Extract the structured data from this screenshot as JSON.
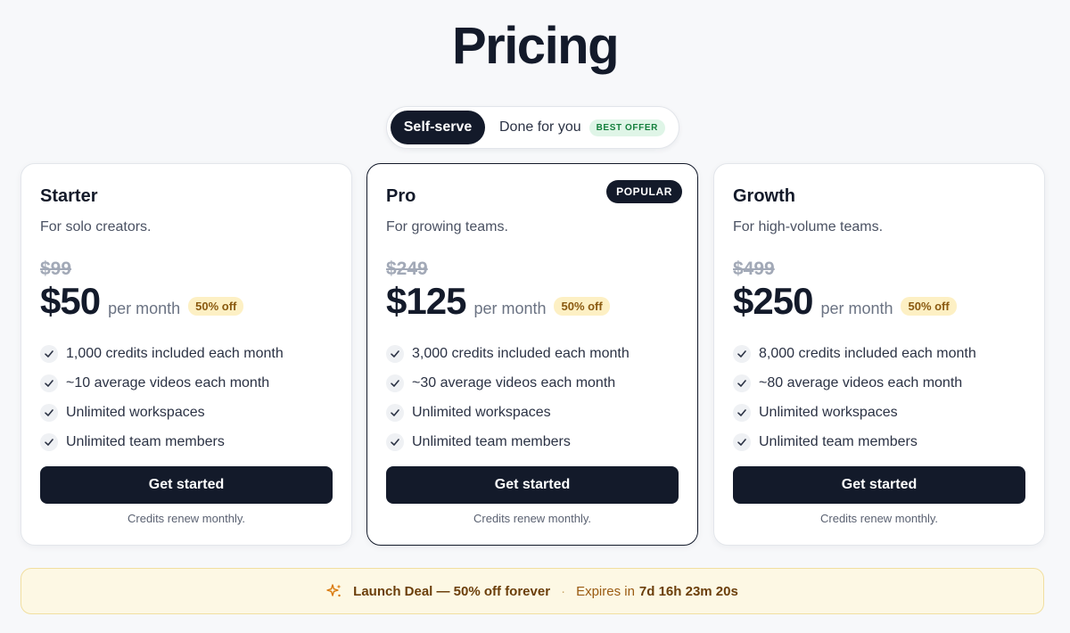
{
  "title": "Pricing",
  "toggle": {
    "self_serve": "Self-serve",
    "done_for_you": "Done for you",
    "badge": "BEST OFFER"
  },
  "plans": [
    {
      "name": "Starter",
      "description": "For solo creators.",
      "original_price": "$99",
      "price": "$50",
      "period": "per month",
      "discount": "50% off",
      "features": [
        "1,000 credits included each month",
        "~10 average videos each month",
        "Unlimited workspaces",
        "Unlimited team members"
      ],
      "cta": "Get started",
      "note": "Credits renew monthly."
    },
    {
      "name": "Pro",
      "badge": "POPULAR",
      "description": "For growing teams.",
      "original_price": "$249",
      "price": "$125",
      "period": "per month",
      "discount": "50% off",
      "features": [
        "3,000 credits included each month",
        "~30 average videos each month",
        "Unlimited workspaces",
        "Unlimited team members"
      ],
      "cta": "Get started",
      "note": "Credits renew monthly."
    },
    {
      "name": "Growth",
      "description": "For high-volume teams.",
      "original_price": "$499",
      "price": "$250",
      "period": "per month",
      "discount": "50% off",
      "features": [
        "8,000 credits included each month",
        "~80 average videos each month",
        "Unlimited workspaces",
        "Unlimited team members"
      ],
      "cta": "Get started",
      "note": "Credits renew monthly."
    }
  ],
  "deal": {
    "icon": "sparkle-icon",
    "title": "Launch Deal — 50% off forever",
    "separator": "·",
    "expires_label": "Expires in",
    "countdown": "7d 16h 23m 20s"
  },
  "colors": {
    "primary": "#131a2a",
    "background": "#f7f8fa",
    "best_offer_bg": "#dff5e7",
    "discount_bg": "#fdf0c4",
    "deal_bg": "#fdf8e4"
  }
}
